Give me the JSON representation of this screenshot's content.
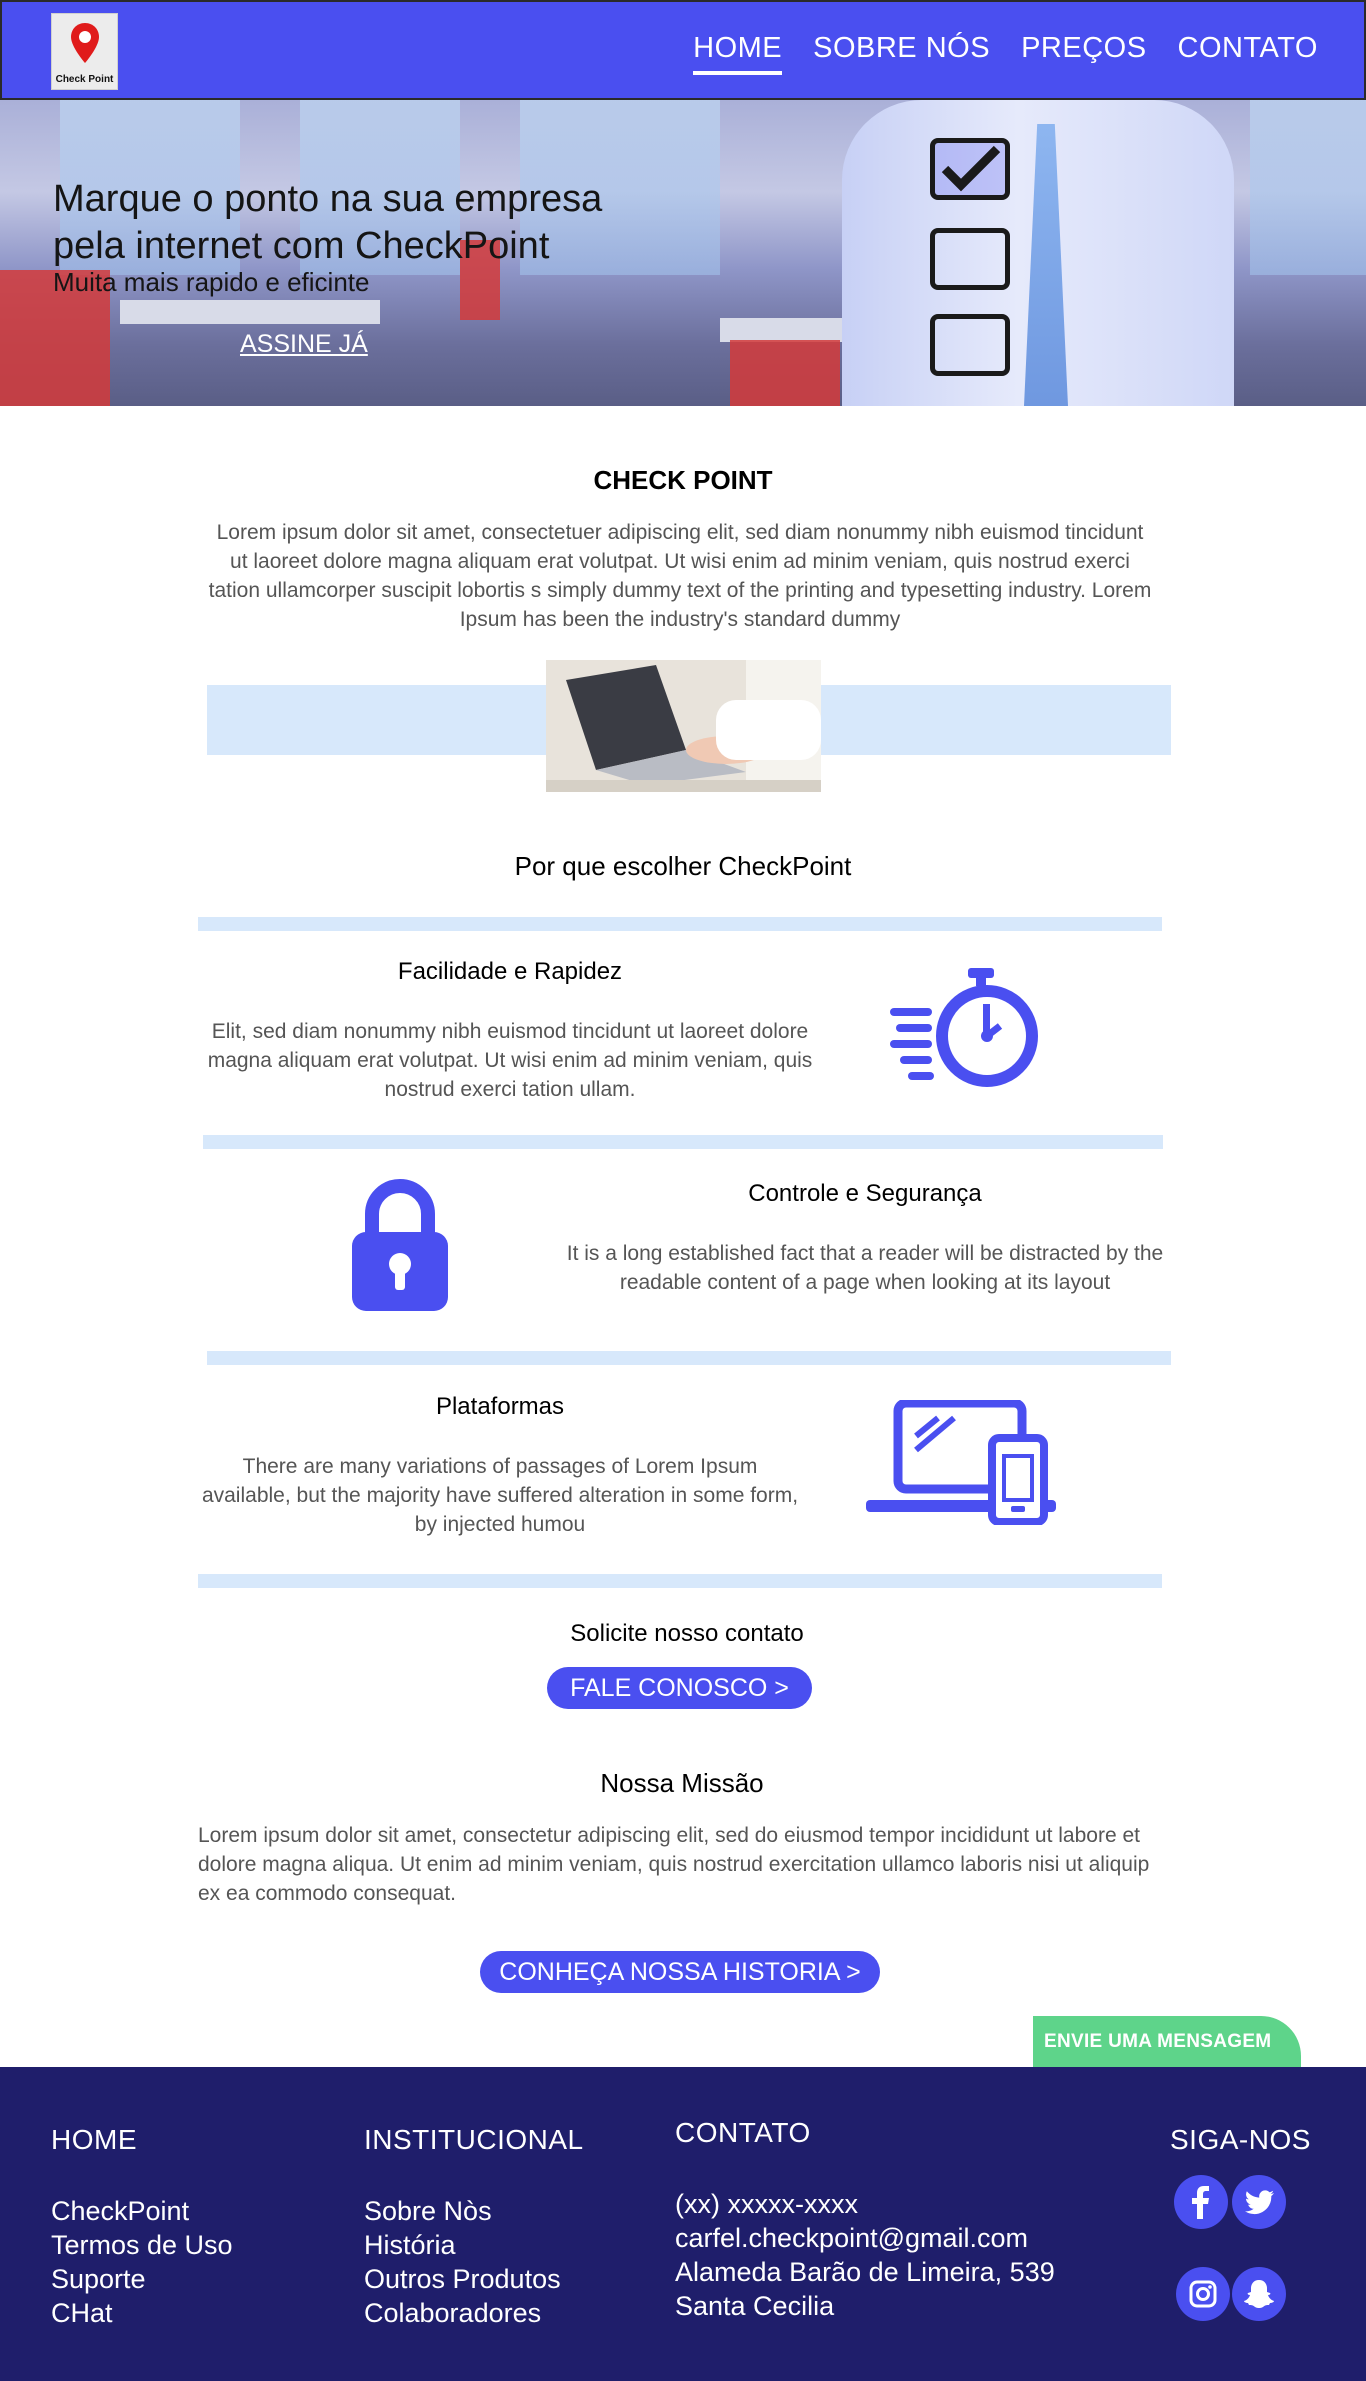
{
  "header": {
    "logo_text": "Check Point",
    "nav": [
      "HOME",
      "SOBRE NÓS",
      "PREÇOS",
      "CONTATO"
    ]
  },
  "hero": {
    "title_line1": "Marque o ponto na sua empresa",
    "title_line2": "pela internet com CheckPoint",
    "subtitle": "Muita mais rapido e eficinte",
    "cta": "ASSINE JÁ"
  },
  "about": {
    "title": "CHECK POINT",
    "text": "Lorem ipsum dolor sit amet, consectetuer adipiscing elit, sed diam nonummy nibh euismod tincidunt ut laoreet dolore magna aliquam erat volutpat. Ut wisi enim ad minim veniam, quis nostrud exerci tation ullamcorper suscipit lobortis s simply dummy text of the printing and typesetting industry. Lorem Ipsum has been the industry's standard dummy"
  },
  "why": {
    "title": "Por que escolher CheckPoint",
    "features": [
      {
        "title": "Facilidade e Rapidez",
        "text": "Elit, sed diam nonummy nibh euismod tincidunt ut laoreet dolore magna aliquam erat volutpat. Ut wisi enim ad minim veniam, quis nostrud exerci tation ullam.",
        "icon": "stopwatch-icon"
      },
      {
        "title": "Controle e Segurança",
        "text": "It is a long established fact that a reader will be distracted by the readable content of a page when looking at its layout",
        "icon": "padlock-icon"
      },
      {
        "title": "Plataformas",
        "text": "There are many variations of passages of Lorem Ipsum available, but the majority have suffered alteration in some form, by injected humou",
        "icon": "devices-icon"
      }
    ]
  },
  "contact_cta": {
    "title": "Solicite nosso contato",
    "button": "FALE CONOSCO >"
  },
  "mission": {
    "title": "Nossa Missão",
    "text": "Lorem ipsum dolor sit amet, consectetur adipiscing elit, sed do eiusmod tempor incididunt ut labore et dolore magna aliqua. Ut enim ad minim veniam, quis nostrud exercitation ullamco laboris nisi ut aliquip ex ea commodo consequat.",
    "button": "CONHEÇA NOSSA HISTORIA >"
  },
  "message_tab": "ENVIE UMA MENSAGEM",
  "footer": {
    "col1": {
      "title": "HOME",
      "items": [
        "CheckPoint",
        "Termos de Uso",
        "Suporte",
        "CHat"
      ]
    },
    "col2": {
      "title": "INSTITUCIONAL",
      "items": [
        "Sobre Nòs",
        "História",
        "Outros Produtos",
        "Colaboradores"
      ]
    },
    "col3": {
      "title": "CONTATO",
      "items": [
        "(xx) xxxxx-xxxx",
        "carfel.checkpoint@gmail.com",
        "Alameda Barão de Limeira, 539",
        "Santa Cecilia"
      ]
    },
    "social": {
      "title": "SIGA-NOS",
      "icons": [
        "facebook-icon",
        "twitter-icon",
        "instagram-icon",
        "snapchat-icon"
      ]
    }
  },
  "colors": {
    "brand": "#4a4ff0",
    "footer": "#1f1e6b",
    "band": "#d7e8fb",
    "message_tab": "#5ed48a"
  }
}
